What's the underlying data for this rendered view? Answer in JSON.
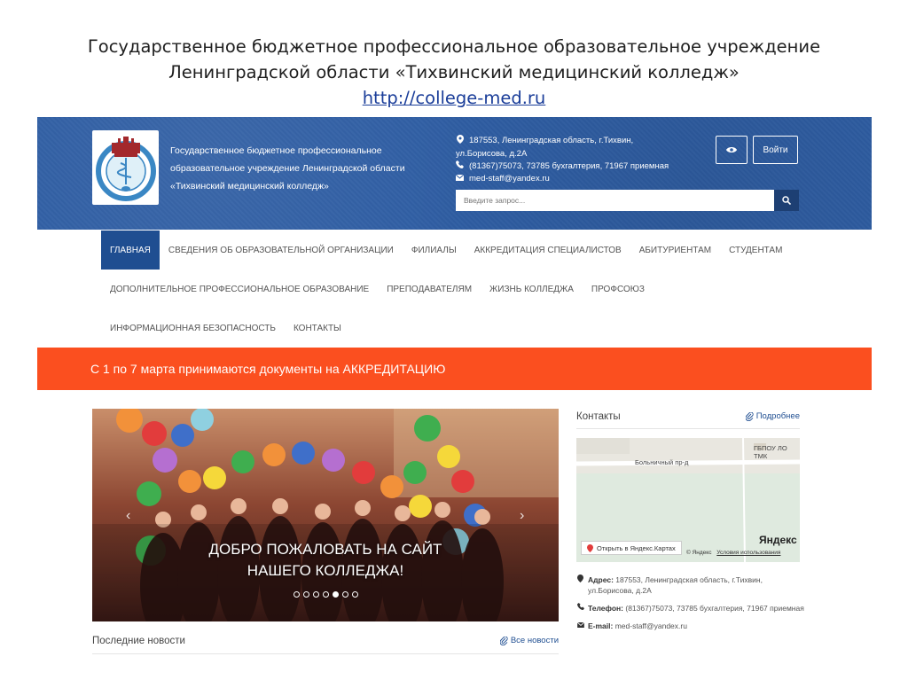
{
  "slide": {
    "title_line1": "Государственное бюджетное профессиональное образовательное учреждение",
    "title_line2": "Ленинградской области «Тихвинский медицинский колледж»",
    "link": "http://college-med.ru"
  },
  "header": {
    "org_line1": "Государственное бюджетное профессиональное",
    "org_line2": "образовательное учреждение Ленинградской области",
    "org_line3": "«Тихвинский медицинский колледж»",
    "address_line1": "187553, Ленинградская область, г.Тихвин,",
    "address_line2": "ул.Борисова, д.2А",
    "phone": "(81367)75073, 73785 бухгалтерия, 71967 приемная",
    "email": "med-staff@yandex.ru",
    "login_label": "Войти",
    "search_placeholder": "Введите запрос..."
  },
  "nav": {
    "row1": [
      "Главная",
      "Сведения об образовательной организации",
      "Филиалы",
      "Аккредитация специалистов",
      "Абитуриентам",
      "Студентам"
    ],
    "row2": [
      "Дополнительное профессиональное образование",
      "Преподавателям",
      "Жизнь колледжа",
      "Профсоюз"
    ],
    "row3": [
      "Информационная безопасность",
      "Контакты"
    ]
  },
  "announcement": "С 1 по 7 марта принимаются документы на АККРЕДИТАЦИЮ",
  "slider": {
    "caption_line1": "ДОБРО ПОЖАЛОВАТЬ НА САЙТ",
    "caption_line2": "НАШЕГО КОЛЛЕДЖА!",
    "slide_count": 7,
    "active_slide": 5
  },
  "news": {
    "heading": "Последние новости",
    "all_link": "Все новости"
  },
  "sidebar": {
    "heading": "Контакты",
    "more_link": "Подробнее",
    "map": {
      "label_building": "ГБПОУ ЛО ТМК",
      "label_street": "Больничный пр-д",
      "open_button": "Открыть в Яндекс.Картах",
      "brand": "Яндекс",
      "copyright": "© Яндекс",
      "terms": "Условия использования"
    },
    "address_label": "Адрес:",
    "address_value_1": "187553, Ленинградская область, г.Тихвин,",
    "address_value_2": "ул.Борисова, д.2А",
    "phone_label": "Телефон:",
    "phone_value": "(81367)75073, 73785 бухгалтерия, 71967 приемная",
    "email_label": "E-mail:",
    "email_value": "med-staff@yandex.ru"
  },
  "colors": {
    "header_bg": "#2f5ea4",
    "nav_active": "#1f4e91",
    "announcement_bg": "#fb4f1f",
    "link": "#1f4e91"
  },
  "icons": [
    "logo-emblem",
    "map-marker-icon",
    "phone-icon",
    "envelope-icon",
    "eye-icon",
    "search-icon",
    "paperclip-icon"
  ]
}
